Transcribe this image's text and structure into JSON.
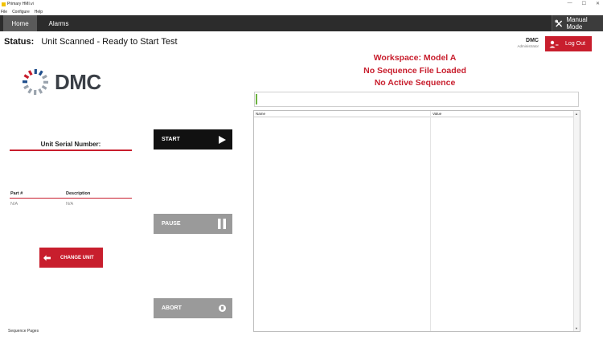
{
  "window": {
    "title": "Primary HMI.vi",
    "controls": {
      "minimize": "—",
      "maximize": "☐",
      "close": "✕"
    }
  },
  "menu": [
    "File",
    "Configure",
    "Help"
  ],
  "nav": {
    "tabs": [
      "Home",
      "Alarms"
    ],
    "manual_mode": "Manual Mode"
  },
  "status": {
    "label": "Status:",
    "text": "Unit Scanned - Ready to Start Test"
  },
  "user": {
    "name": "DMC",
    "role": "Administrator",
    "logout": "Log Out"
  },
  "workspace": {
    "line1": "Workspace: Model A",
    "line2": "No Sequence File Loaded",
    "line3": "No Active Sequence"
  },
  "logo": {
    "text": "DMC",
    "dot_colors": [
      "#c81e2d",
      "#1f4e8c",
      "#9aa3ad"
    ]
  },
  "unit": {
    "serial_label": "Unit Serial Number:",
    "part_header": "Part #",
    "description_header": "Description",
    "part_value": "N/A",
    "description_value": "N/A",
    "change_unit": "CHANGE UNIT"
  },
  "actions": {
    "start": "START",
    "pause": "PAUSE",
    "abort": "ABORT"
  },
  "grid": {
    "columns": [
      "Name",
      "Value"
    ]
  },
  "footer": {
    "sequence_pages": "Sequence Pages"
  },
  "colors": {
    "accent_red": "#c81e2d",
    "nav_dark": "#2c2c2c",
    "disabled_gray": "#9a9a9a"
  }
}
